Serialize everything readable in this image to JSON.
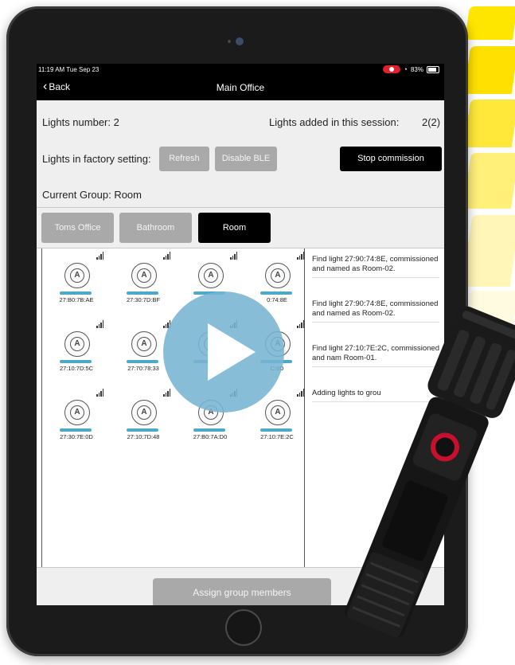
{
  "status_bar": {
    "time": "11:19 AM  Tue Sep 23",
    "battery": "83%"
  },
  "nav": {
    "back_label": "Back",
    "title": "Main Office"
  },
  "summary": {
    "lights_number_label": "Lights number: 2",
    "lights_added_label": "Lights added in this session:",
    "lights_added_value": "2(2)"
  },
  "factory": {
    "label": "Lights in factory setting:",
    "refresh_label": "Refresh",
    "disable_ble_label": "Disable BLE",
    "stop_commission_label": "Stop commission"
  },
  "group": {
    "current_label": "Current Group:  Room",
    "tabs": [
      {
        "label": "Toms Office"
      },
      {
        "label": "Bathroom"
      },
      {
        "label": "Room"
      }
    ]
  },
  "lights": [
    {
      "mac": "27:B0:7B:AE"
    },
    {
      "mac": "27:30:7D:BF"
    },
    {
      "mac": ""
    },
    {
      "mac": "0:74:8E"
    },
    {
      "mac": "27:10:7D:5C"
    },
    {
      "mac": "27:70:78:33"
    },
    {
      "mac": ""
    },
    {
      "mac": "C:8D"
    },
    {
      "mac": "27:30:7E:0D"
    },
    {
      "mac": "27:10:7D:48"
    },
    {
      "mac": "27:B0:7A:D0"
    },
    {
      "mac": "27:10:7E:2C"
    }
  ],
  "log": [
    {
      "text": "Find light 27:90:74:8E, commissioned and named as Room-02."
    },
    {
      "text": "Find light 27:90:74:8E, commissioned and named as Room-02."
    },
    {
      "text": "Find light 27:10:7E:2C, commissioned and nam Room-01."
    },
    {
      "text": "Adding lights to grou"
    }
  ],
  "footer": {
    "assign_label": "Assign group members"
  },
  "colors": {
    "accent_bar": "#4ea9c9",
    "stop_button": "#000000",
    "play_overlay": "#78b4d2",
    "beam": "#ffe600"
  }
}
